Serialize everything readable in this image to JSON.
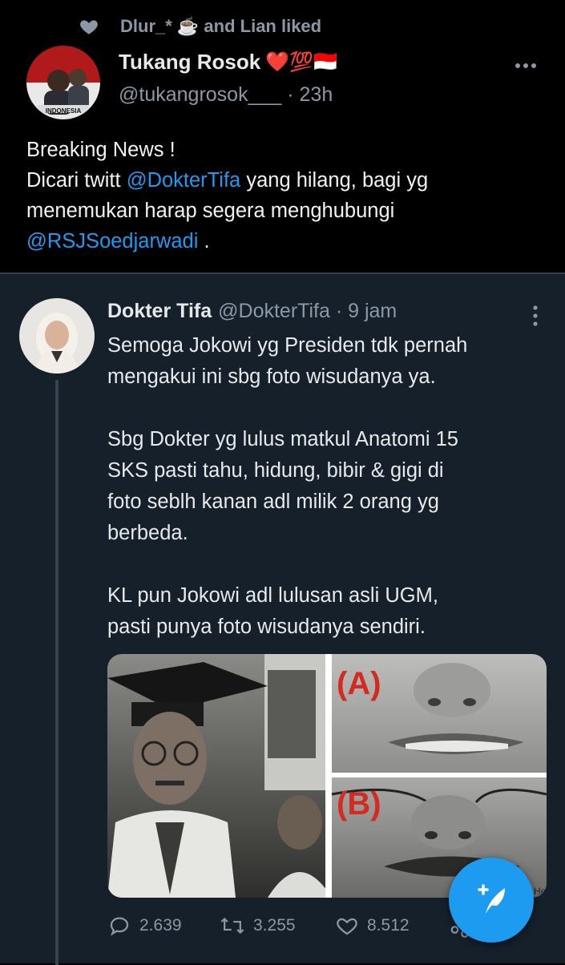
{
  "social_context": {
    "text": "Dlur_* ☕ and Lian liked"
  },
  "tweet": {
    "name": "Tukang Rosok",
    "name_emoji": "❤️💯🇮🇩",
    "handle": "@tukangrosok___",
    "time": "· 23h",
    "line1": "Breaking News !",
    "line2_pre": "Dicari twitt ",
    "mention1": "@DokterTifa",
    "line2_post": " yang hilang, bagi yg",
    "line3": "menemukan harap segera menghubungi",
    "mention2": "@RSJSoedjarwadi",
    "line4_post": " .",
    "avatar_caption": "INDONESIA"
  },
  "quote": {
    "name": "Dokter Tifa",
    "handle": "@DokterTifa · 9 jam",
    "text": "Semoga Jokowi yg Presiden tdk pernah\nmengakui ini sbg foto wisudanya ya.\n\nSbg Dokter yg  lulus matkul  Anatomi  15\nSKS pasti tahu,  hidung, bibir & gigi di\nfoto seblh kanan adl milik 2 orang yg\nberbeda.\n\nKL pun Jokowi adl lulusan asli UGM,\npasti punya foto wisudanya sendiri.",
    "label_a": "(A)",
    "label_b": "(B)",
    "corner_text": "He",
    "replies": "2.639",
    "retweets": "3.255",
    "likes": "8.512"
  },
  "icons": {
    "liked": "heart-icon",
    "more": "more-horizontal-icon",
    "reply": "reply-icon",
    "retweet": "retweet-icon",
    "like": "like-icon",
    "compose": "compose-icon"
  },
  "colors": {
    "accent": "#1d9bf0",
    "background": "#000000",
    "card": "#15202b",
    "muted": "#8b98a5"
  }
}
